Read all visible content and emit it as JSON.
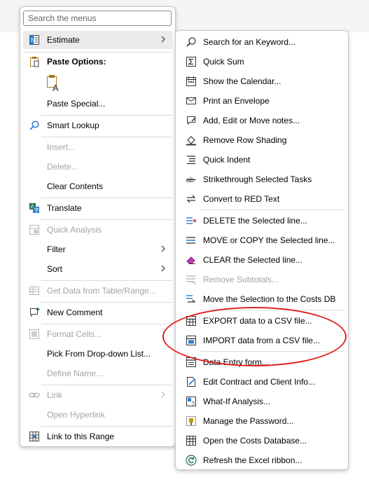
{
  "colors": {
    "accent": "#2b7cd3",
    "excel_green": "#217346",
    "highlight_ring": "#e0201c",
    "disabled": "#a3a3a3"
  },
  "main_menu": {
    "search_placeholder": "Search the menus",
    "estimate": "Estimate",
    "paste_options_heading": "Paste Options:",
    "paste_special": "Paste Special...",
    "smart_lookup": "Smart Lookup",
    "insert": "Insert...",
    "delete": "Delete...",
    "clear_contents": "Clear Contents",
    "translate": "Translate",
    "quick_analysis": "Quick Analysis",
    "filter": "Filter",
    "sort": "Sort",
    "get_data": "Get Data from Table/Range...",
    "new_comment": "New Comment",
    "format_cells": "Format Cells...",
    "pick_from_list": "Pick From Drop-down List...",
    "define_name": "Define Name...",
    "link": "Link",
    "open_hyperlink": "Open Hyperlink",
    "link_to_range": "Link to this Range"
  },
  "sub_menu": {
    "search_keyword": "Search for an Keyword...",
    "quick_sum": "Quick Sum",
    "show_calendar": "Show the Calendar...",
    "print_envelope": "Print an Envelope",
    "notes": "Add, Edit or Move notes...",
    "remove_shading": "Remove Row Shading",
    "quick_indent": "Quick Indent",
    "strikethrough": "Strikethrough Selected Tasks",
    "red_text": "Convert to RED Text",
    "delete_line": "DELETE the Selected line...",
    "move_copy_line": "MOVE or COPY the Selected line...",
    "clear_line": "CLEAR the Selected line...",
    "remove_subtotals": "Remove Subtotals...",
    "move_to_costs_db": "Move the Selection to the Costs DB",
    "export_csv": "EXPORT data to a CSV file...",
    "import_csv": "IMPORT data from a CSV file...",
    "data_entry": "Data Entry form...",
    "contract_info": "Edit Contract and Client Info...",
    "what_if": "What-If Analysis...",
    "manage_password": "Manage the Password...",
    "open_costs_db": "Open the Costs Database...",
    "refresh_ribbon": "Refresh the Excel ribbon..."
  }
}
